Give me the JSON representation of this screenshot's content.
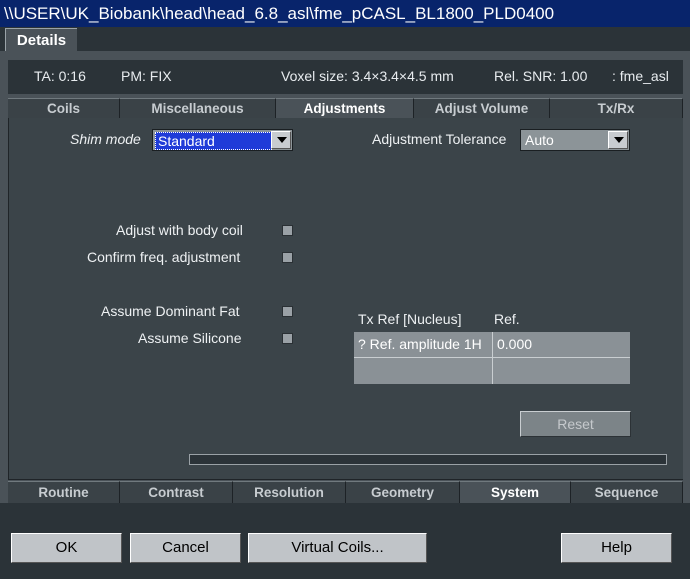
{
  "window": {
    "title": "\\\\USER\\UK_Biobank\\head\\head_6.8_asl\\fme_pCASL_BL1800_PLD0400"
  },
  "top_tab": {
    "label": "Details"
  },
  "info": {
    "ta": "TA: 0:16",
    "pm": "PM: FIX",
    "voxel": "Voxel size: 3.4×3.4×4.5 mm",
    "snr": "Rel. SNR: 1.00",
    "seq": ": fme_asl"
  },
  "sub_tabs": [
    "Coils",
    "Miscellaneous",
    "Adjustments",
    "Adjust Volume",
    "Tx/Rx"
  ],
  "sub_tab_active": "Adjustments",
  "shim": {
    "label": "Shim mode",
    "value": "Standard"
  },
  "tolerance": {
    "label": "Adjustment Tolerance",
    "value": "Auto"
  },
  "checks": {
    "body_coil": "Adjust with body coil",
    "confirm_freq": "Confirm freq. adjustment",
    "dominant_fat": "Assume Dominant Fat",
    "silicone": "Assume Silicone"
  },
  "tx_table": {
    "headers": [
      "Tx Ref [Nucleus]",
      "Ref."
    ],
    "rows": [
      [
        "? Ref. amplitude 1H",
        "0.000"
      ]
    ]
  },
  "reset_label": "Reset",
  "bottom_tabs": [
    "Routine",
    "Contrast",
    "Resolution",
    "Geometry",
    "System",
    "Sequence"
  ],
  "bottom_tab_active": "System",
  "buttons": {
    "ok": "OK",
    "cancel": "Cancel",
    "virtual_coils": "Virtual Coils...",
    "help": "Help"
  },
  "colors": {
    "title_bg": "#08246b",
    "selection": "#1f3bd8",
    "panel": "#4a5258"
  }
}
